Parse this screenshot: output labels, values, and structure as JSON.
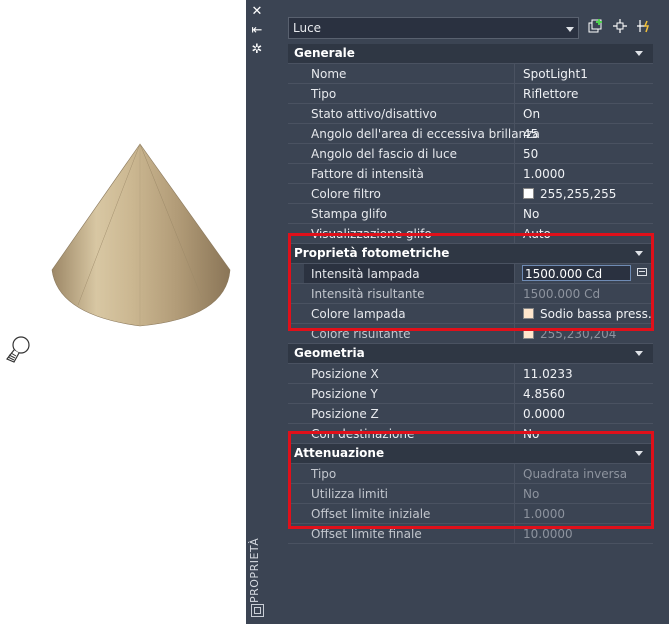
{
  "palette": {
    "side_title": "PROPRIETÀ",
    "object_type": "Luce",
    "sections": {
      "generale": {
        "title": "Generale",
        "rows": [
          {
            "name": "Nome",
            "value": "SpotLight1"
          },
          {
            "name": "Tipo",
            "value": "Riflettore"
          },
          {
            "name": "Stato attivo/disattivo",
            "value": "On"
          },
          {
            "name": "Angolo dell'area di eccessiva brillanza",
            "value": "45"
          },
          {
            "name": "Angolo del fascio di luce",
            "value": "50"
          },
          {
            "name": "Fattore di intensità",
            "value": "1.0000"
          },
          {
            "name": "Colore filtro",
            "value": "255,255,255",
            "swatch": "#ffffff"
          },
          {
            "name": "Stampa glifo",
            "value": "No"
          },
          {
            "name": "Visualizzazione glifo",
            "value": "Auto"
          }
        ]
      },
      "fotometriche": {
        "title": "Proprietà fotometriche",
        "rows": [
          {
            "name": "Intensità lampada",
            "value": "1500.000 Cd"
          },
          {
            "name": "Intensità risultante",
            "value": "1500.000 Cd"
          },
          {
            "name": "Colore lampada",
            "value": "Sodio bassa press.",
            "swatch": "#ffe6cc"
          },
          {
            "name": "Colore risultante",
            "value": "255,230,204",
            "swatch": "#ffe6cc"
          }
        ]
      },
      "geometria": {
        "title": "Geometria",
        "rows": [
          {
            "name": "Posizione X",
            "value": "11.0233"
          },
          {
            "name": "Posizione Y",
            "value": "4.8560"
          },
          {
            "name": "Posizione Z",
            "value": "0.0000"
          },
          {
            "name": "Con destinazione",
            "value": "No"
          }
        ]
      },
      "attenuazione": {
        "title": "Attenuazione",
        "rows": [
          {
            "name": "Tipo",
            "value": "Quadrata inversa"
          },
          {
            "name": "Utilizza limiti",
            "value": "No"
          },
          {
            "name": "Offset limite iniziale",
            "value": "1.0000"
          },
          {
            "name": "Offset limite finale",
            "value": "10.0000"
          }
        ]
      }
    }
  },
  "colors": {
    "panel_bg": "#3b4453",
    "section_bg": "#2f3744",
    "highlight_border": "#e0101a",
    "cone": "#c8b48f"
  },
  "icons": [
    "close-icon",
    "pin-icon",
    "settings-icon",
    "quick-select-icon",
    "select-objects-icon",
    "toggle-pickadd-icon"
  ]
}
